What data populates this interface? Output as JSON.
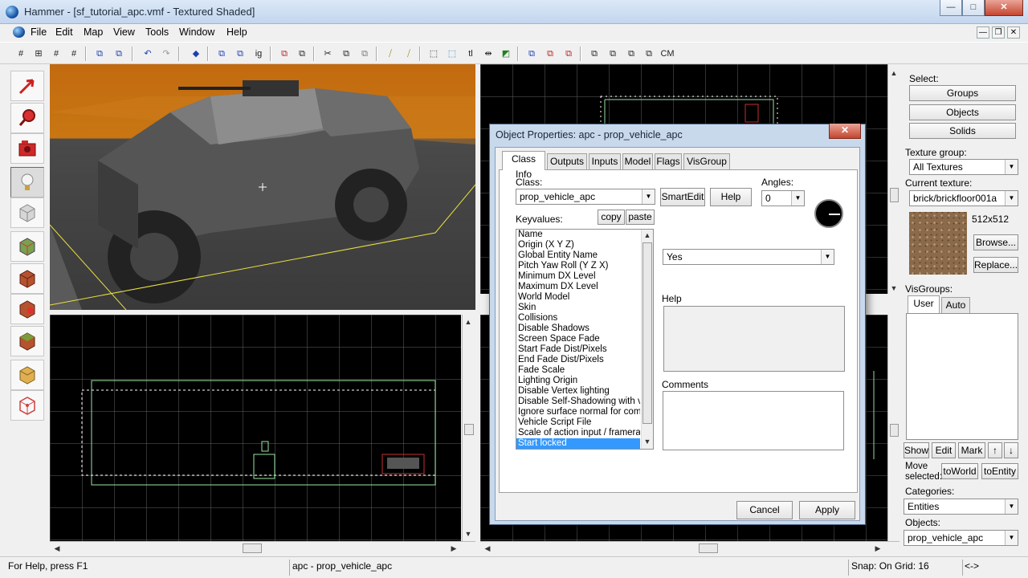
{
  "window": {
    "title": "Hammer - [sf_tutorial_apc.vmf - Textured Shaded]",
    "controls": {
      "minimize": "—",
      "maximize": "□",
      "close": "✕"
    },
    "mdi_controls": {
      "minimize": "—",
      "restore": "❐",
      "close": "✕"
    }
  },
  "menu": [
    "File",
    "Edit",
    "Map",
    "View",
    "Tools",
    "Window",
    "Help"
  ],
  "toolbar": {
    "buttons": [
      "#",
      "⊞",
      "#",
      "#",
      "⧉",
      "⧉",
      "↶",
      "↷",
      "◆",
      "⧉",
      "⧉",
      "ig",
      "⧉",
      "⧉",
      "✂",
      "⧉",
      "⧉",
      "⧸",
      "⧸",
      "⬚",
      "⬚",
      "tl",
      "⇹",
      "◩",
      "⧉",
      "⧉",
      "⧉",
      "⧉",
      "⧉",
      "⧉",
      "⧉",
      "CM"
    ]
  },
  "tools": [
    {
      "name": "selection-tool",
      "icon": "arrow-icon",
      "color": "#cc2020"
    },
    {
      "name": "magnify-tool",
      "icon": "magnifier-icon",
      "color": "#cc2020"
    },
    {
      "name": "camera-tool",
      "icon": "camera-icon",
      "color": "#cc2020"
    },
    {
      "name": "entity-tool",
      "icon": "lightbulb-icon",
      "color": "#d8d8d8"
    },
    {
      "name": "block-tool",
      "icon": "cube-icon",
      "color": "#cfcfcf"
    },
    {
      "name": "texture-application-tool",
      "icon": "texture-cube-icon",
      "color": "#7a9c4a"
    },
    {
      "name": "apply-current-texture-tool",
      "icon": "brick-cube-icon",
      "color": "#b5532f"
    },
    {
      "name": "decal-tool",
      "icon": "decal-cube-icon",
      "color": "#b5532f"
    },
    {
      "name": "overlay-tool",
      "icon": "overlay-cube-icon",
      "color": "#7a8c3a"
    },
    {
      "name": "clipping-tool",
      "icon": "clip-cube-icon",
      "color": "#e0b050"
    },
    {
      "name": "vertex-tool",
      "icon": "vertex-cube-icon",
      "color": "#d04040"
    }
  ],
  "dialog": {
    "title": "Object Properties: apc - prop_vehicle_apc",
    "tabs": [
      "Class Info",
      "Outputs",
      "Inputs",
      "Model",
      "Flags",
      "VisGroup"
    ],
    "class_label": "Class:",
    "class_value": "prop_vehicle_apc",
    "smart_edit": "SmartEdit",
    "help_btn": "Help",
    "angles_label": "Angles:",
    "angles_value": "0",
    "keyvalues_label": "Keyvalues:",
    "copy": "copy",
    "paste": "paste",
    "keyvalues": [
      "Name",
      "Origin (X Y Z)",
      "Global Entity Name",
      "Pitch Yaw Roll (Y Z X)",
      "Minimum DX Level",
      "Maximum DX Level",
      "World Model",
      "Skin",
      "Collisions",
      "Disable Shadows",
      "Screen Space Fade",
      "Start Fade Dist/Pixels",
      "End Fade Dist/Pixels",
      "Fade Scale",
      "Lighting Origin",
      "Disable Vertex lighting",
      "Disable Self-Shadowing with vertex lighting",
      "Ignore surface normal for computing vertex lighting",
      "Vehicle Script File",
      "Scale of action input / framerate",
      "Start locked"
    ],
    "selected_key": "Start locked",
    "value_select": "Yes",
    "help_label": "Help",
    "comments_label": "Comments",
    "cancel": "Cancel",
    "apply": "Apply"
  },
  "right_panel": {
    "select_label": "Select:",
    "select_buttons": [
      "Groups",
      "Objects",
      "Solids"
    ],
    "texture_group_label": "Texture group:",
    "texture_group": "All Textures",
    "current_texture_label": "Current texture:",
    "current_texture": "brick/brickfloor001a",
    "texture_size": "512x512",
    "browse": "Browse...",
    "replace": "Replace...",
    "visgroups_label": "VisGroups:",
    "vis_tabs": [
      "User",
      "Auto"
    ],
    "show": "Show",
    "edit": "Edit",
    "mark": "Mark",
    "move_selected_label": "Move selected:",
    "to_world": "toWorld",
    "to_entity": "toEntity",
    "categories_label": "Categories:",
    "categories": "Entities",
    "objects_label": "Objects:",
    "objects": "prop_vehicle_apc"
  },
  "status": {
    "help": "For Help, press F1",
    "selection": "apc - prop_vehicle_apc",
    "snap": "Snap: On Grid: 16",
    "nav": "<->"
  },
  "colors": {
    "accent_selection": "#3399ff",
    "grid_line": "#5a5a5a",
    "brush_outline": "#9be3a4",
    "bbox_yellow": "#e8e040",
    "entity_red": "#c83030"
  }
}
